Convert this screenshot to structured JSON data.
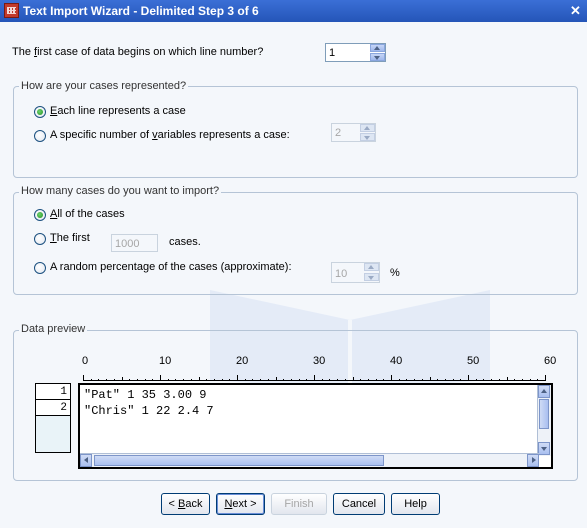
{
  "window": {
    "title": "Text Import Wizard - Delimited Step 3 of 6",
    "close_glyph": "✕"
  },
  "first_line": {
    "label_pre": "The ",
    "label_u": "f",
    "label_post": "irst case of data begins on which line number?",
    "value": "1"
  },
  "cases_group": {
    "legend": "How are your cases represented?",
    "each_line": {
      "u": "E",
      "rest": "ach line represents a case",
      "selected": true
    },
    "specific": {
      "pre": "A specific number of ",
      "u": "v",
      "post": "ariables represents a case:",
      "value": "2",
      "selected": false
    }
  },
  "import_group": {
    "legend": "How many cases do you want to import?",
    "all": {
      "u": "A",
      "rest": "ll of the cases",
      "selected": true
    },
    "first": {
      "u": "T",
      "rest": "he first",
      "value": "1000",
      "suffix": "cases.",
      "selected": false
    },
    "random": {
      "label": "A random percentage of the cases (approximate):",
      "value": "10",
      "suffix": "%",
      "selected": false
    }
  },
  "preview": {
    "legend": "Data preview",
    "ruler_labels": [
      "0",
      "10",
      "20",
      "30",
      "40",
      "50",
      "60"
    ],
    "rows": [
      {
        "num": "1",
        "text": "\"Pat\" 1 35 3.00 9"
      },
      {
        "num": "2",
        "text": "\"Chris\" 1 22 2.4 7"
      }
    ]
  },
  "buttons": {
    "back": {
      "pre": "< ",
      "u": "B",
      "post": "ack"
    },
    "next": {
      "u": "N",
      "post": "ext >"
    },
    "finish": "Finish",
    "cancel": "Cancel",
    "help": "Help"
  },
  "colors": {
    "titlebar": "#2b5fc6",
    "accent": "#003c74",
    "background": "#f4f7fb"
  }
}
